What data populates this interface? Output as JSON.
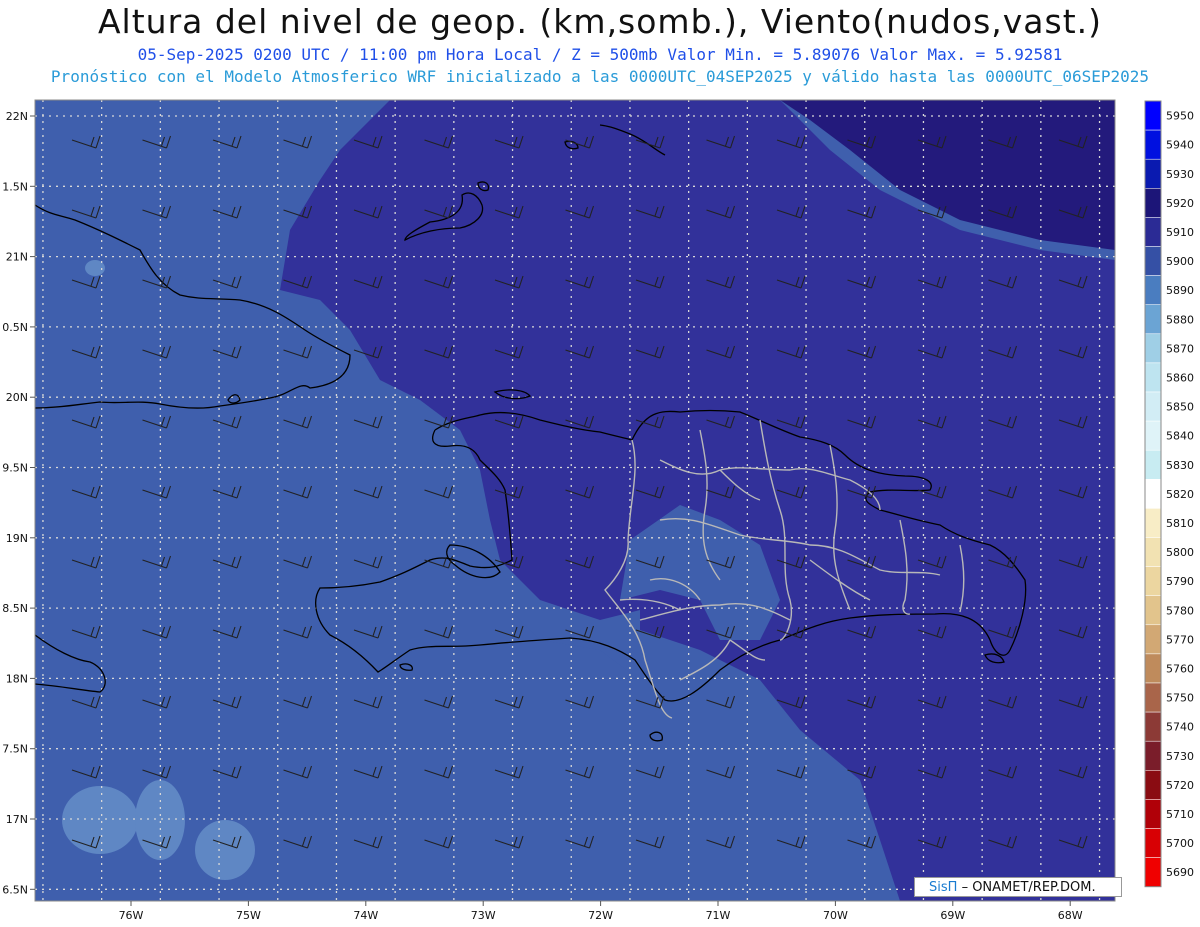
{
  "header": {
    "title": "Altura del nivel de geop. (km,somb.), Viento(nudos,vast.)",
    "line1": "05-Sep-2025  0200 UTC / 11:00 pm Hora Local / Z = 500mb    Valor Min. = 5.89076  Valor Max. = 5.92581",
    "line2": "Pronóstico con el Modelo Atmosferico WRF inicializado a las 0000UTC_04SEP2025 y válido hasta las  0000UTC_06SEP2025"
  },
  "map": {
    "lat_labels": [
      "22N",
      "1.5N",
      "21N",
      "0.5N",
      "20N",
      "9.5N",
      "19N",
      "8.5N",
      "18N",
      "7.5N",
      "17N",
      "6.5N"
    ],
    "lon_labels": [
      "76W",
      "75W",
      "74W",
      "73W",
      "72W",
      "71W",
      "70W",
      "69W",
      "68W"
    ],
    "colors": {
      "band_5890": "#3f5fad",
      "band_5900": "#3a54a6",
      "band_5910": "#32319a",
      "band_5920": "#231a7c",
      "band_5880": "#5f87c4"
    }
  },
  "colorbar": {
    "levels": [
      "5950",
      "5940",
      "5930",
      "5920",
      "5910",
      "5900",
      "5890",
      "5880",
      "5870",
      "5860",
      "5850",
      "5840",
      "5830",
      "5820",
      "5810",
      "5800",
      "5790",
      "5780",
      "5770",
      "5760",
      "5750",
      "5740",
      "5730",
      "5720",
      "5710",
      "5700",
      "5690"
    ],
    "colors": [
      "#0000ff",
      "#0010e0",
      "#0a1ab0",
      "#1c1578",
      "#2b2b95",
      "#3550a5",
      "#4a7dc0",
      "#6ba4d4",
      "#9fcfe6",
      "#bee4f0",
      "#d2edf5",
      "#dff3f8",
      "#c8ecf2",
      "#ffffff",
      "#f8edc6",
      "#f2e2b2",
      "#ecd6a0",
      "#e2c48c",
      "#d2a874",
      "#bf8b5c",
      "#a9654a",
      "#8c3a36",
      "#7a1d2a",
      "#8a0c12",
      "#b00008",
      "#d80004",
      "#f00000"
    ]
  },
  "credit": {
    "brand": "SisΠ",
    "org": "– ONAMET/REP.DOM."
  }
}
